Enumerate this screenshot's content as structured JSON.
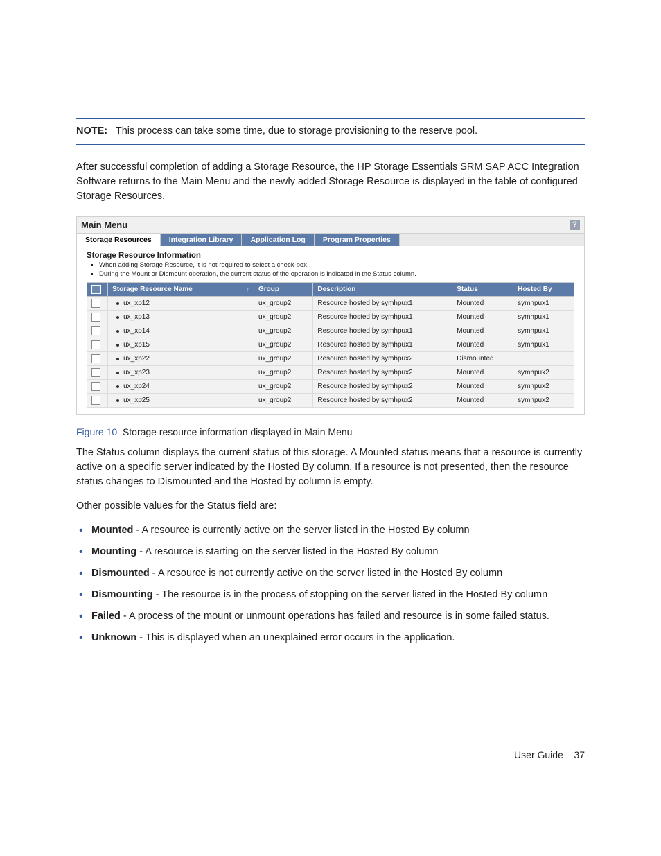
{
  "note": {
    "label": "NOTE:",
    "text": "This process can take some time, due to storage provisioning to the reserve pool."
  },
  "paragraphs": {
    "p1": "After successful completion of adding a Storage Resource, the HP Storage Essentials SRM SAP ACC Integration Software returns to the Main Menu and the newly added Storage Resource is displayed in the table of configured Storage Resources.",
    "p2": "The Status column displays the current status of this storage. A Mounted status means that a resource is currently active on a specific server indicated by the Hosted By column. If a resource is not presented, then the resource status changes to Dismounted and the Hosted by column is empty.",
    "p3": "Other possible values for the Status field are:"
  },
  "figure": {
    "label": "Figure 10",
    "caption": "Storage resource information displayed in Main Menu"
  },
  "mainMenu": {
    "title": "Main Menu",
    "tabs": {
      "t0": "Storage Resources",
      "t1": "Integration Library",
      "t2": "Application Log",
      "t3": "Program Properties"
    },
    "section": "Storage Resource Information",
    "hints": {
      "h0": "When adding Storage Resource, it is not required to select a check-box.",
      "h1": "During the Mount or Dismount operation, the current status of the operation is indicated in the Status column."
    },
    "columns": {
      "name": "Storage Resource Name",
      "group": "Group",
      "desc": "Description",
      "status": "Status",
      "hosted": "Hosted By"
    },
    "rows": [
      {
        "name": "ux_xp12",
        "group": "ux_group2",
        "desc": "Resource hosted by symhpux1",
        "status": "Mounted",
        "hosted": "symhpux1"
      },
      {
        "name": "ux_xp13",
        "group": "ux_group2",
        "desc": "Resource hosted by symhpux1",
        "status": "Mounted",
        "hosted": "symhpux1"
      },
      {
        "name": "ux_xp14",
        "group": "ux_group2",
        "desc": "Resource hosted by symhpux1",
        "status": "Mounted",
        "hosted": "symhpux1"
      },
      {
        "name": "ux_xp15",
        "group": "ux_group2",
        "desc": "Resource hosted by symhpux1",
        "status": "Mounted",
        "hosted": "symhpux1"
      },
      {
        "name": "ux_xp22",
        "group": "ux_group2",
        "desc": "Resource hosted by symhpux2",
        "status": "Dismounted",
        "hosted": ""
      },
      {
        "name": "ux_xp23",
        "group": "ux_group2",
        "desc": "Resource hosted by symhpux2",
        "status": "Mounted",
        "hosted": "symhpux2"
      },
      {
        "name": "ux_xp24",
        "group": "ux_group2",
        "desc": "Resource hosted by symhpux2",
        "status": "Mounted",
        "hosted": "symhpux2"
      },
      {
        "name": "ux_xp25",
        "group": "ux_group2",
        "desc": "Resource hosted by symhpux2",
        "status": "Mounted",
        "hosted": "symhpux2"
      }
    ]
  },
  "definitions": [
    {
      "term": "Mounted",
      "text": " - A resource is currently active on the server listed in the Hosted By column"
    },
    {
      "term": "Mounting",
      "text": " - A resource is starting on the server listed in the Hosted By column"
    },
    {
      "term": "Dismounted",
      "text": " - A resource is not currently active on the server listed in the Hosted By column"
    },
    {
      "term": "Dismounting",
      "text": " - The resource is in the process of stopping on the server listed in the Hosted By column"
    },
    {
      "term": "Failed",
      "text": " - A process of the mount or unmount operations has failed and resource is in some failed status."
    },
    {
      "term": "Unknown",
      "text": " - This is displayed when an unexplained error occurs in the application."
    }
  ],
  "footer": {
    "title": "User Guide",
    "page": "37"
  }
}
